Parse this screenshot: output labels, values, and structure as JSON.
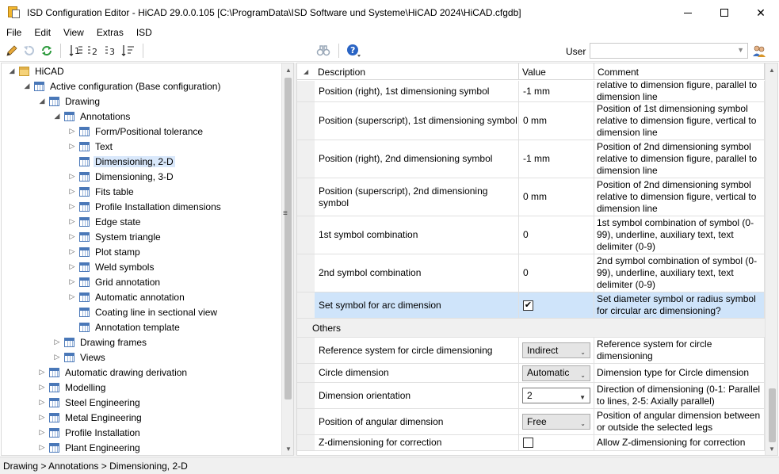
{
  "window": {
    "title": "ISD Configuration Editor  -  HiCAD 29.0.0.105 [C:\\ProgramData\\ISD Software und Systeme\\HiCAD 2024\\HiCAD.cfgdb]"
  },
  "menu": [
    "File",
    "Edit",
    "View",
    "Extras",
    "ISD"
  ],
  "toolbar": {
    "user_label": "User",
    "user_value": ""
  },
  "tree": [
    {
      "label": "HiCAD",
      "level": 0,
      "exp": "open",
      "icon": "folder"
    },
    {
      "label": "Active configuration (Base configuration)",
      "level": 1,
      "exp": "open",
      "icon": "grid"
    },
    {
      "label": "Drawing",
      "level": 2,
      "exp": "open",
      "icon": "grid"
    },
    {
      "label": "Annotations",
      "level": 3,
      "exp": "open",
      "icon": "grid"
    },
    {
      "label": "Form/Positional tolerance",
      "level": 4,
      "exp": "closed",
      "icon": "grid"
    },
    {
      "label": "Text",
      "level": 4,
      "exp": "closed",
      "icon": "grid"
    },
    {
      "label": "Dimensioning, 2-D",
      "level": 4,
      "exp": "none",
      "icon": "grid",
      "selected": true
    },
    {
      "label": "Dimensioning, 3-D",
      "level": 4,
      "exp": "closed",
      "icon": "grid"
    },
    {
      "label": "Fits table",
      "level": 4,
      "exp": "closed",
      "icon": "grid"
    },
    {
      "label": "Profile Installation dimensions",
      "level": 4,
      "exp": "closed",
      "icon": "grid"
    },
    {
      "label": "Edge state",
      "level": 4,
      "exp": "closed",
      "icon": "grid"
    },
    {
      "label": "System triangle",
      "level": 4,
      "exp": "closed",
      "icon": "grid"
    },
    {
      "label": "Plot stamp",
      "level": 4,
      "exp": "closed",
      "icon": "grid"
    },
    {
      "label": "Weld symbols",
      "level": 4,
      "exp": "closed",
      "icon": "grid"
    },
    {
      "label": "Grid annotation",
      "level": 4,
      "exp": "closed",
      "icon": "grid"
    },
    {
      "label": "Automatic annotation",
      "level": 4,
      "exp": "closed",
      "icon": "grid"
    },
    {
      "label": "Coating line in sectional view",
      "level": 4,
      "exp": "none",
      "icon": "grid"
    },
    {
      "label": "Annotation template",
      "level": 4,
      "exp": "none",
      "icon": "grid"
    },
    {
      "label": "Drawing frames",
      "level": 3,
      "exp": "closed",
      "icon": "grid"
    },
    {
      "label": "Views",
      "level": 3,
      "exp": "closed",
      "icon": "grid"
    },
    {
      "label": "Automatic drawing derivation",
      "level": 2,
      "exp": "closed",
      "icon": "grid"
    },
    {
      "label": "Modelling",
      "level": 2,
      "exp": "closed",
      "icon": "grid"
    },
    {
      "label": "Steel Engineering",
      "level": 2,
      "exp": "closed",
      "icon": "grid"
    },
    {
      "label": "Metal Engineering",
      "level": 2,
      "exp": "closed",
      "icon": "grid"
    },
    {
      "label": "Profile Installation",
      "level": 2,
      "exp": "closed",
      "icon": "grid"
    },
    {
      "label": "Plant Engineering",
      "level": 2,
      "exp": "closed",
      "icon": "grid"
    }
  ],
  "grid": {
    "columns": [
      "Description",
      "Value",
      "Comment"
    ],
    "rows": [
      {
        "desc": "Position (right), 1st dimensioning symbol",
        "value": "-1 mm",
        "comment": "relative to dimension figure, parallel to dimension line",
        "h": 27
      },
      {
        "desc": "Position (superscript), 1st dimensioning symbol",
        "value": "0 mm",
        "comment": "Position of 1st dimensioning symbol relative to dimension figure, vertical to dimension line",
        "h": 48
      },
      {
        "desc": "Position (right), 2nd dimensioning symbol",
        "value": "-1 mm",
        "comment": "Position of 2nd dimensioning symbol relative to dimension figure, parallel to dimension line",
        "h": 48
      },
      {
        "desc": "Position (superscript), 2nd dimensioning symbol",
        "value": "0 mm",
        "comment": "Position of 2nd dimensioning symbol relative to dimension figure, vertical to dimension line",
        "h": 48
      },
      {
        "desc": "1st symbol combination",
        "value": "0",
        "comment": "1st symbol combination of symbol (0-99), underline, auxiliary text, text delimiter (0-9)",
        "h": 48
      },
      {
        "desc": "2nd symbol combination",
        "value": "0",
        "comment": "2nd symbol combination of symbol (0-99), underline, auxiliary text, text delimiter (0-9)",
        "h": 48
      },
      {
        "desc": "Set symbol for arc dimension",
        "value": "checked",
        "comment": "Set diameter symbol or radius symbol for circular arc dimensioning?",
        "h": 33,
        "type": "check",
        "selected": true
      }
    ],
    "group": "Others",
    "group_rows": [
      {
        "desc": "Reference system for circle dimensioning",
        "value": "Indirect",
        "comment": "Reference system for circle dimensioning",
        "h": 33,
        "type": "combo"
      },
      {
        "desc": "Circle dimension",
        "value": "Automatic",
        "comment": "Dimension type for Circle dimension",
        "h": 24,
        "type": "combo"
      },
      {
        "desc": "Dimension orientation",
        "value": "2",
        "comment": "Direction of dimensioning (0-1: Parallel to lines, 2-5: Axially parallel)",
        "h": 33,
        "type": "combo-white"
      },
      {
        "desc": "Position of angular dimension",
        "value": "Free",
        "comment": "Position of angular dimension between or outside the selected legs",
        "h": 33,
        "type": "combo"
      },
      {
        "desc": "Z-dimensioning for correction",
        "value": "unchecked",
        "comment": "Allow Z-dimensioning for correction",
        "h": 20,
        "type": "check"
      }
    ]
  },
  "status": {
    "breadcrumb": "Drawing > Annotations > Dimensioning, 2-D"
  }
}
